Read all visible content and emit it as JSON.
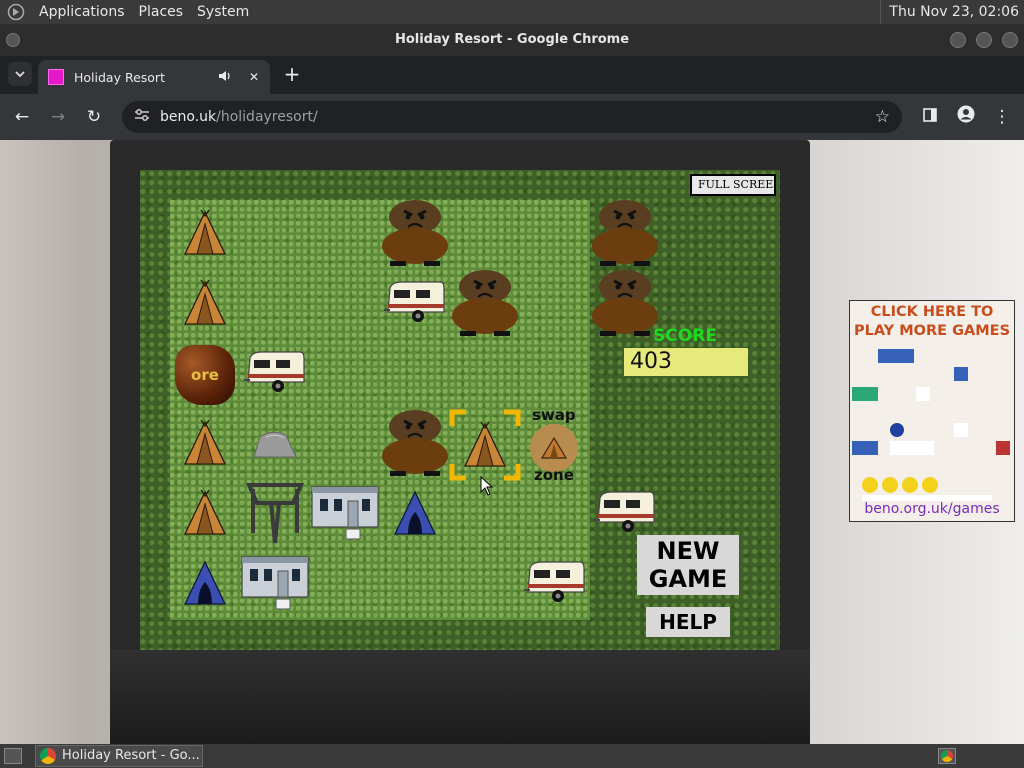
{
  "panel": {
    "menus": [
      "Applications",
      "Places",
      "System"
    ],
    "clock": "Thu Nov 23, 02:06"
  },
  "window": {
    "title": "Holiday Resort - Google Chrome"
  },
  "tab": {
    "title": "Holiday Resort",
    "audio_icon": "speaker-icon",
    "favicon_color": "#e619c9"
  },
  "toolbar": {
    "url_host": "beno.uk",
    "url_path": "/holidayresort/"
  },
  "game": {
    "fullscreen_label": "FULL SCREEN",
    "score_label": "SCORE",
    "score_value": "403",
    "swap_label": "swap",
    "zone_label": "zone",
    "new_game_label": "NEW GAME",
    "help_label": "HELP",
    "ore_label": "ore",
    "grid": [
      [
        "tent-orange",
        "",
        "",
        "bear",
        "",
        "",
        "bear"
      ],
      [
        "tent-orange",
        "",
        "",
        "caravan",
        "bear",
        "",
        "bear"
      ],
      [
        "ore",
        "caravan",
        "",
        "",
        "",
        "",
        ""
      ],
      [
        "tent-orange",
        "rock",
        "",
        "bear",
        "",
        "",
        ""
      ],
      [
        "tent-orange",
        "frame",
        "mobile-home",
        "tent-blue",
        "",
        "",
        "caravan"
      ],
      [
        "tent-blue",
        "mobile-home",
        "",
        "",
        "",
        "caravan",
        ""
      ]
    ],
    "selected_cell": "tent-orange"
  },
  "ad": {
    "text_line1": "CLICK HERE TO",
    "text_line2": "PLAY MORE GAMES",
    "url": "beno.org.uk/games"
  },
  "taskbar": {
    "task_title": "Holiday Resort - Go..."
  },
  "colors": {
    "score_text": "#1fd81f",
    "score_bg": "#e5ea7a",
    "selection": "#f2b800"
  }
}
